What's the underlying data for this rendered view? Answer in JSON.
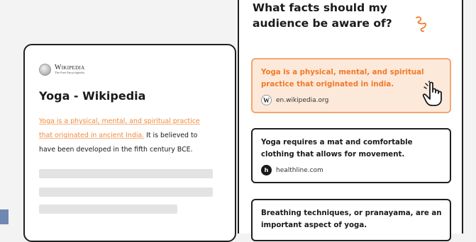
{
  "wikipedia": {
    "logo_name": "Wikipedia",
    "logo_tagline": "The Free Encyclopedia",
    "page_title": "Yoga - Wikipedia",
    "highlighted_text": "Yoga is a physical, mental, and spiritual practice that originated in ancient India.",
    "body_text": " It is believed to have been developed in the fifth century BCE."
  },
  "panel": {
    "question": "What facts should my audience be aware of?",
    "facts": [
      {
        "text": "Yoga is a physical, mental, and spiritual practice that originated in india.",
        "source": "en.wikipedia.org",
        "source_icon": "wikipedia-w-icon",
        "selected": true
      },
      {
        "text": "Yoga requires a mat and comfortable clothing that allows for movement.",
        "source": "healthline.com",
        "source_icon": "healthline-h-icon",
        "selected": false
      },
      {
        "text": "Breathing techniques, or pranayama, are an important aspect of yoga.",
        "source": "",
        "source_icon": "",
        "selected": false
      }
    ]
  },
  "colors": {
    "accent_orange": "#f07a2a",
    "selected_bg": "#fde9da",
    "border_dark": "#1f1f1f"
  }
}
